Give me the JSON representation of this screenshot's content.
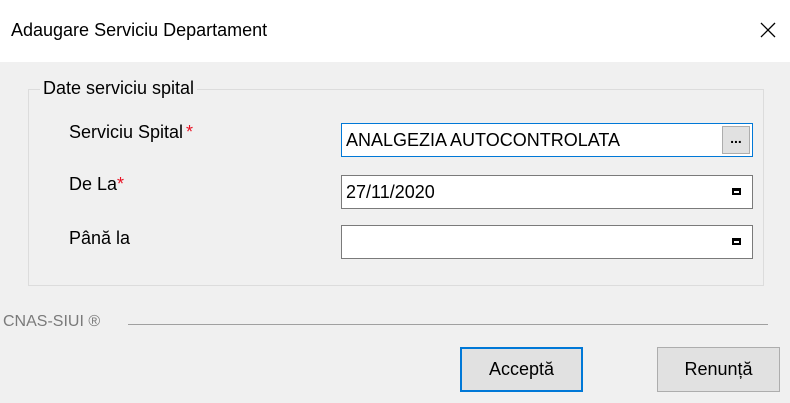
{
  "window": {
    "title": "Adaugare Serviciu Departament",
    "close_icon": "close-icon"
  },
  "group": {
    "legend": "Date serviciu spital"
  },
  "fields": {
    "serviciu": {
      "label": "Serviciu Spital",
      "required_mark": "*",
      "value": "ANALGEZIA AUTOCONTROLATA",
      "button_label": "..."
    },
    "de_la": {
      "label": "De La",
      "required_mark": "*",
      "value": "27/11/2020",
      "icon": "calendar-icon"
    },
    "pana_la": {
      "label": "Până la",
      "value": "",
      "icon": "calendar-icon"
    }
  },
  "footer": {
    "brand": "CNAS-SIUI ®"
  },
  "buttons": {
    "accept": "Acceptă",
    "cancel": "Renunță"
  },
  "colors": {
    "accent": "#0078d7",
    "required": "#e81123",
    "background": "#f0f0f0"
  }
}
